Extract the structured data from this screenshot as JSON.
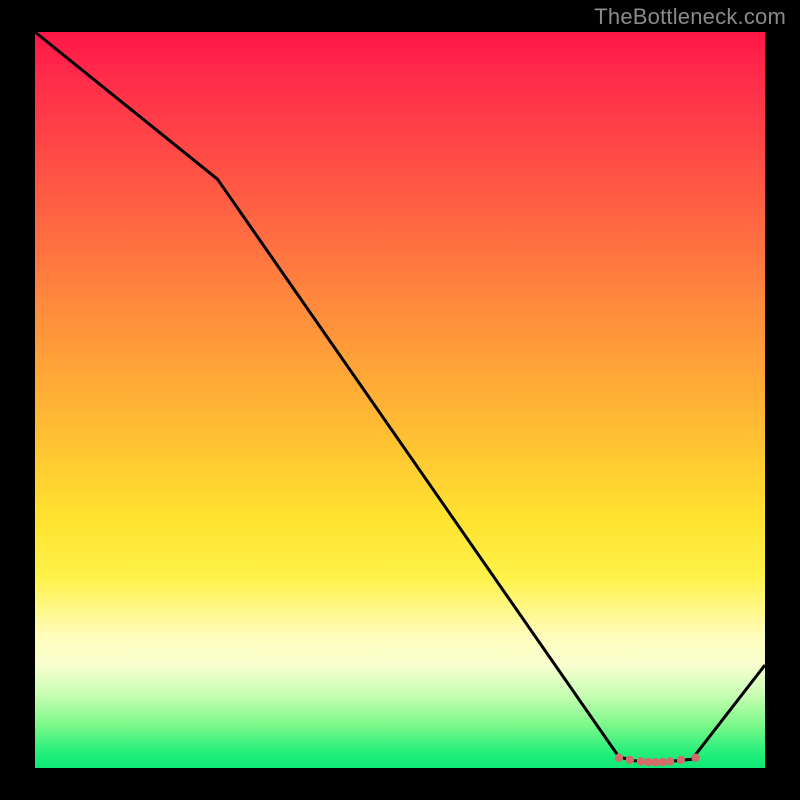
{
  "attribution": "TheBottleneck.com",
  "chart_data": {
    "type": "line",
    "title": "",
    "xlabel": "",
    "ylabel": "",
    "xlim": [
      0,
      100
    ],
    "ylim": [
      0,
      100
    ],
    "series": [
      {
        "name": "curve",
        "x": [
          0,
          25,
          80,
          82,
          84,
          86,
          88,
          90,
          100
        ],
        "y": [
          100,
          80,
          1.5,
          1.0,
          0.8,
          0.8,
          1.0,
          1.2,
          14
        ]
      }
    ],
    "markers": {
      "name": "bottom-cluster",
      "x": [
        80,
        81.5,
        83,
        84,
        85,
        86,
        87,
        88.5,
        90.5
      ],
      "y": [
        1.4,
        1.1,
        0.9,
        0.8,
        0.8,
        0.8,
        0.9,
        1.1,
        1.4
      ],
      "color": "#d46a6a",
      "radius": 4.2
    },
    "gradient_stops": [
      {
        "pos": 0,
        "color": "#ff1747"
      },
      {
        "pos": 22,
        "color": "#ff5b44"
      },
      {
        "pos": 54,
        "color": "#ffbd33"
      },
      {
        "pos": 74,
        "color": "#fff249"
      },
      {
        "pos": 86,
        "color": "#f7fecf"
      },
      {
        "pos": 100,
        "color": "#0ee876"
      }
    ]
  }
}
